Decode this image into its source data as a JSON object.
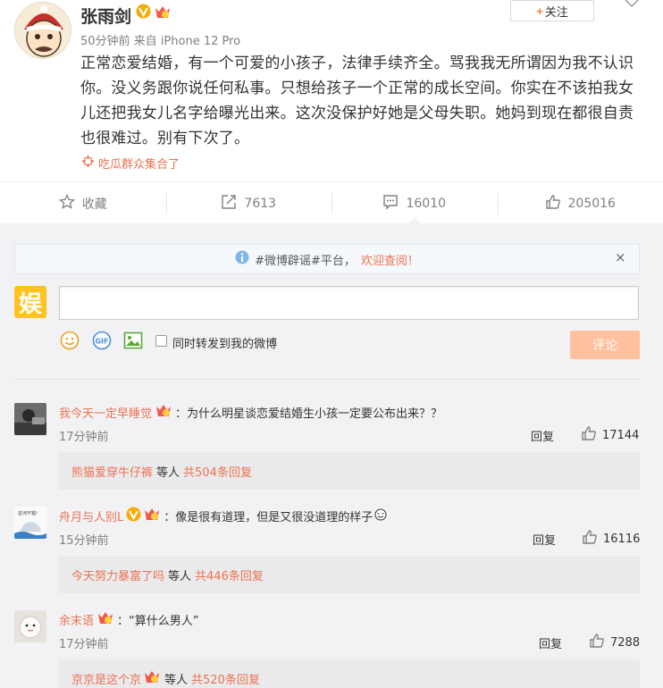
{
  "post": {
    "author": "张雨剑",
    "follow_label": "关注",
    "meta": "50分钟前 来自 iPhone 12 Pro",
    "text": "正常恋爱结婚，有一个可爱的小孩子，法律手续齐全。骂我我无所谓因为我不认识你。没义务跟你说任何私事。只想给孩子一个正常的成长空间。你实在不该拍我女儿还把我女儿名字给曝光出来。这次没保护好她是父母失职。她妈到现在都很自责也很难过。别有下次了。",
    "source": "吃瓜群众集合了"
  },
  "actions": {
    "favorite": "收藏",
    "repost": "7613",
    "comment": "16010",
    "like": "205016"
  },
  "notice": {
    "prefix": "#微博辟谣#平台，",
    "highlight": "欢迎查阅！",
    "close": "×"
  },
  "composer": {
    "logo": "娱",
    "input_value": "",
    "forward_label": "同时转发到我的微博",
    "submit_label": "评论"
  },
  "comments": [
    {
      "name": "我今天一定早睡觉",
      "text": "：为什么明星谈恋爱结婚生小孩一定要公布出来？？",
      "time": "17分钟前",
      "reply": "回复",
      "likes": "17144",
      "sub_user": "熊猫爱穿牛仔裤",
      "sub_mid": "等人",
      "sub_count": "共504条回复"
    },
    {
      "name": "舟月与人别L",
      "text": "：像是很有道理，但是又很没道理的样子",
      "time": "15分钟前",
      "reply": "回复",
      "likes": "16116",
      "sub_user": "今天努力暴富了吗",
      "sub_mid": "等人",
      "sub_count": "共446条回复"
    },
    {
      "name": "余末语",
      "text": "：“算什么男人”",
      "time": "17分钟前",
      "reply": "回复",
      "likes": "7288",
      "sub_user": "京京是这个京",
      "sub_mid": "等人",
      "sub_count": "共520条回复"
    }
  ],
  "colors": {
    "accent": "#eb7350",
    "brand_orange": "#fa7d3c",
    "submit_disabled": "#ffc09f",
    "verified_gold": "#f6ab00"
  },
  "icons": [
    "chevron-down-icon",
    "verified-icon",
    "member-badge-icon",
    "star-icon",
    "repost-icon",
    "comment-icon",
    "thumb-up-icon",
    "info-icon",
    "emoji-icon",
    "gif-icon",
    "image-icon"
  ]
}
